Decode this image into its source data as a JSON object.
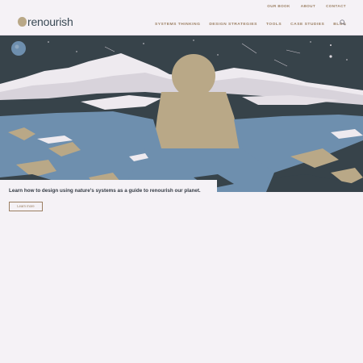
{
  "utility_nav": [
    "OUR BOOK",
    "ABOUT",
    "CONTACT"
  ],
  "logo": {
    "text": "renourish"
  },
  "main_nav": [
    "SYSTEMS THINKING",
    "DESIGN STRATEGIES",
    "TOOLS",
    "CASE STUDIES",
    "BLOG"
  ],
  "search": {
    "icon": "search-icon"
  },
  "hero": {
    "tagline": "Learn how to design using nature's systems as a guide to renourish our planet.",
    "button_label": "Learn more"
  },
  "colors": {
    "accent": "#9b7f62",
    "sand": "#b9a887",
    "slate": "#37434a",
    "blue": "#6e8fae",
    "background": "#f5f2f6"
  }
}
